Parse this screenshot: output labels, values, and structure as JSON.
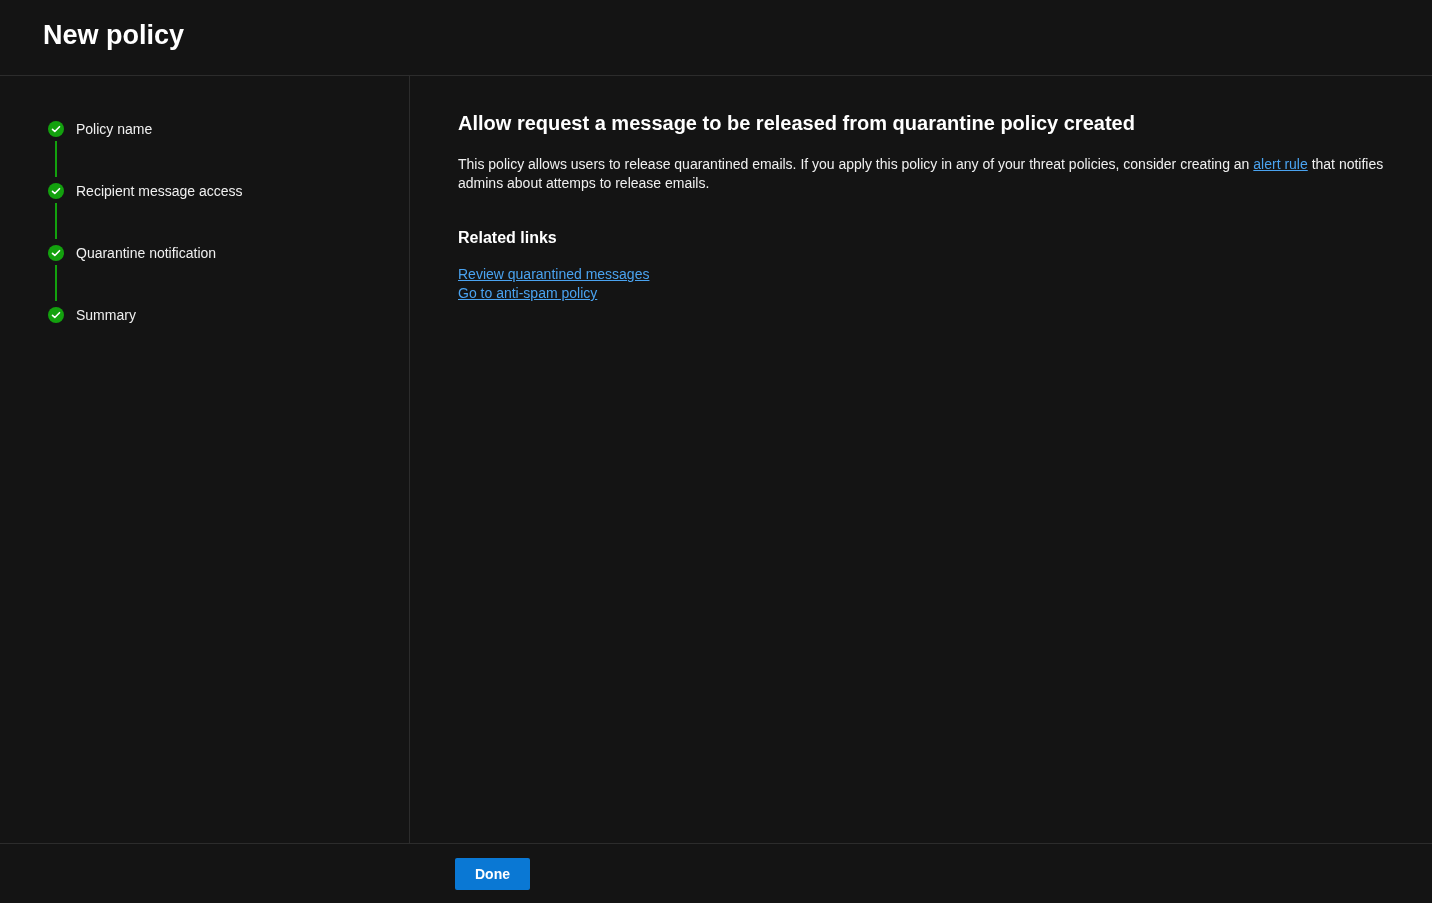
{
  "title": "New policy",
  "steps": [
    {
      "label": "Policy name",
      "completed": true
    },
    {
      "label": "Recipient message access",
      "completed": true
    },
    {
      "label": "Quarantine notification",
      "completed": true
    },
    {
      "label": "Summary",
      "completed": true
    }
  ],
  "heading": "Allow request a message to be released from quarantine policy created",
  "description": {
    "before": "This policy allows users to release quarantined emails. If you apply this policy in any of your threat policies, consider creating an",
    "link": "alert rule",
    "after": "that notifies admins about attemps to release emails."
  },
  "related_links": {
    "title": "Related links",
    "links": [
      "Review quarantined messages",
      "Go to anti-spam policy"
    ]
  },
  "buttons": [
    {
      "label": "Done",
      "kind": "primary"
    }
  ]
}
